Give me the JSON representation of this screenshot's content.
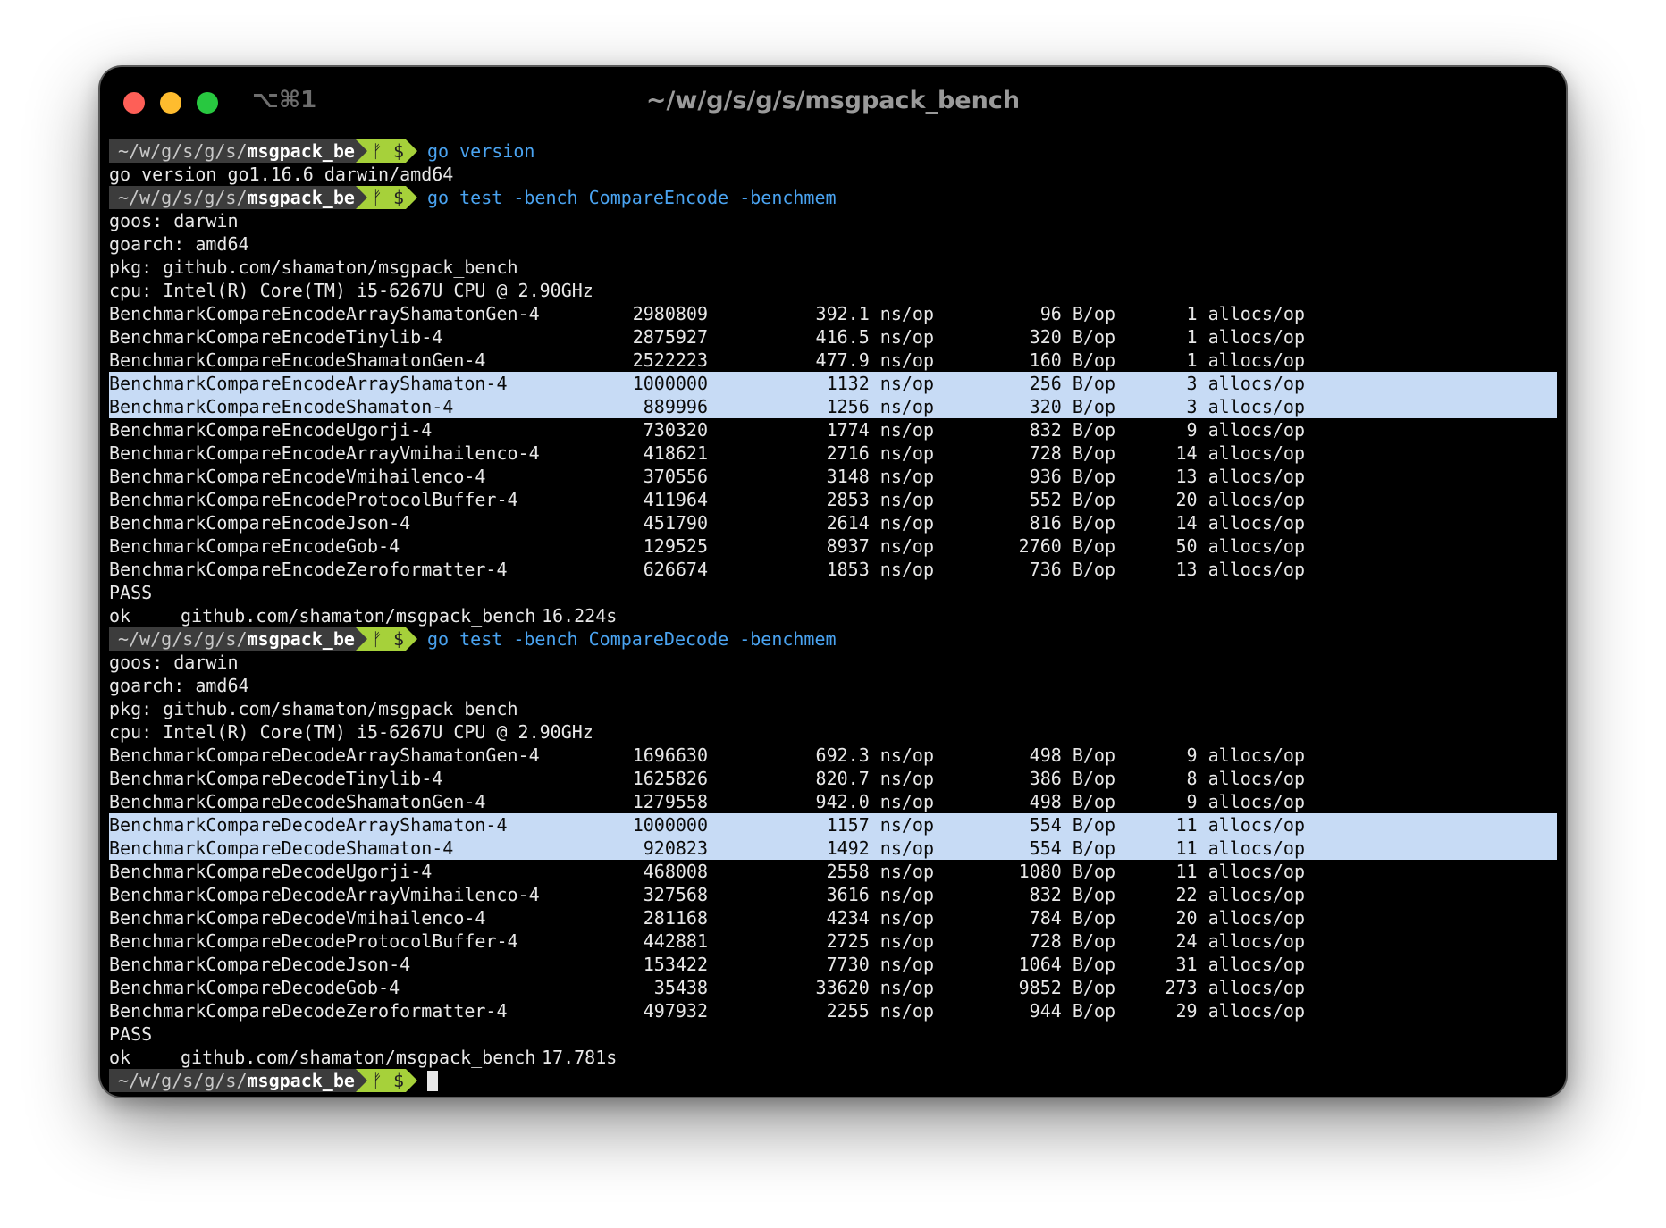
{
  "window": {
    "shortcut": "⌥⌘1",
    "title": "~/w/g/s/g/s/msgpack_bench"
  },
  "prompt": {
    "path_prefix": "~/w/g/s/g/s/",
    "path_dir": "msgpack_bench",
    "git_symbol": "ᚠ $"
  },
  "cmd1": {
    "command": "go version",
    "output": "go version go1.16.6 darwin/amd64"
  },
  "encode": {
    "command": "go test -bench CompareEncode -benchmem",
    "goos": "goos: darwin",
    "goarch": "goarch: amd64",
    "pkg": "pkg: github.com/shamaton/msgpack_bench",
    "cpu": "cpu: Intel(R) Core(TM) i5-6267U CPU @ 2.90GHz",
    "rows": [
      {
        "name": "BenchmarkCompareEncodeArrayShamatonGen-4",
        "iter": "2980809",
        "ns": "392.1 ns/op",
        "bytes": "96 B/op",
        "allocs": "1 allocs/op"
      },
      {
        "name": "BenchmarkCompareEncodeTinylib-4",
        "iter": "2875927",
        "ns": "416.5 ns/op",
        "bytes": "320 B/op",
        "allocs": "1 allocs/op"
      },
      {
        "name": "BenchmarkCompareEncodeShamatonGen-4",
        "iter": "2522223",
        "ns": "477.9 ns/op",
        "bytes": "160 B/op",
        "allocs": "1 allocs/op"
      },
      {
        "name": "BenchmarkCompareEncodeArrayShamaton-4",
        "iter": "1000000",
        "ns": "1132 ns/op",
        "bytes": "256 B/op",
        "allocs": "3 allocs/op"
      },
      {
        "name": "BenchmarkCompareEncodeShamaton-4",
        "iter": "889996",
        "ns": "1256 ns/op",
        "bytes": "320 B/op",
        "allocs": "3 allocs/op"
      },
      {
        "name": "BenchmarkCompareEncodeUgorji-4",
        "iter": "730320",
        "ns": "1774 ns/op",
        "bytes": "832 B/op",
        "allocs": "9 allocs/op"
      },
      {
        "name": "BenchmarkCompareEncodeArrayVmihailenco-4",
        "iter": "418621",
        "ns": "2716 ns/op",
        "bytes": "728 B/op",
        "allocs": "14 allocs/op"
      },
      {
        "name": "BenchmarkCompareEncodeVmihailenco-4",
        "iter": "370556",
        "ns": "3148 ns/op",
        "bytes": "936 B/op",
        "allocs": "13 allocs/op"
      },
      {
        "name": "BenchmarkCompareEncodeProtocolBuffer-4",
        "iter": "411964",
        "ns": "2853 ns/op",
        "bytes": "552 B/op",
        "allocs": "20 allocs/op"
      },
      {
        "name": "BenchmarkCompareEncodeJson-4",
        "iter": "451790",
        "ns": "2614 ns/op",
        "bytes": "816 B/op",
        "allocs": "14 allocs/op"
      },
      {
        "name": "BenchmarkCompareEncodeGob-4",
        "iter": "129525",
        "ns": "8937 ns/op",
        "bytes": "2760 B/op",
        "allocs": "50 allocs/op"
      },
      {
        "name": "BenchmarkCompareEncodeZeroformatter-4",
        "iter": "626674",
        "ns": "1853 ns/op",
        "bytes": "736 B/op",
        "allocs": "13 allocs/op"
      }
    ],
    "pass": "PASS",
    "ok_label": "ok",
    "ok_pkg": "github.com/shamaton/msgpack_bench",
    "ok_time": "16.224s"
  },
  "decode": {
    "command": "go test -bench CompareDecode -benchmem",
    "goos": "goos: darwin",
    "goarch": "goarch: amd64",
    "pkg": "pkg: github.com/shamaton/msgpack_bench",
    "cpu": "cpu: Intel(R) Core(TM) i5-6267U CPU @ 2.90GHz",
    "rows": [
      {
        "name": "BenchmarkCompareDecodeArrayShamatonGen-4",
        "iter": "1696630",
        "ns": "692.3 ns/op",
        "bytes": "498 B/op",
        "allocs": "9 allocs/op"
      },
      {
        "name": "BenchmarkCompareDecodeTinylib-4",
        "iter": "1625826",
        "ns": "820.7 ns/op",
        "bytes": "386 B/op",
        "allocs": "8 allocs/op"
      },
      {
        "name": "BenchmarkCompareDecodeShamatonGen-4",
        "iter": "1279558",
        "ns": "942.0 ns/op",
        "bytes": "498 B/op",
        "allocs": "9 allocs/op"
      },
      {
        "name": "BenchmarkCompareDecodeArrayShamaton-4",
        "iter": "1000000",
        "ns": "1157 ns/op",
        "bytes": "554 B/op",
        "allocs": "11 allocs/op"
      },
      {
        "name": "BenchmarkCompareDecodeShamaton-4",
        "iter": "920823",
        "ns": "1492 ns/op",
        "bytes": "554 B/op",
        "allocs": "11 allocs/op"
      },
      {
        "name": "BenchmarkCompareDecodeUgorji-4",
        "iter": "468008",
        "ns": "2558 ns/op",
        "bytes": "1080 B/op",
        "allocs": "11 allocs/op"
      },
      {
        "name": "BenchmarkCompareDecodeArrayVmihailenco-4",
        "iter": "327568",
        "ns": "3616 ns/op",
        "bytes": "832 B/op",
        "allocs": "22 allocs/op"
      },
      {
        "name": "BenchmarkCompareDecodeVmihailenco-4",
        "iter": "281168",
        "ns": "4234 ns/op",
        "bytes": "784 B/op",
        "allocs": "20 allocs/op"
      },
      {
        "name": "BenchmarkCompareDecodeProtocolBuffer-4",
        "iter": "442881",
        "ns": "2725 ns/op",
        "bytes": "728 B/op",
        "allocs": "24 allocs/op"
      },
      {
        "name": "BenchmarkCompareDecodeJson-4",
        "iter": "153422",
        "ns": "7730 ns/op",
        "bytes": "1064 B/op",
        "allocs": "31 allocs/op"
      },
      {
        "name": "BenchmarkCompareDecodeGob-4",
        "iter": "35438",
        "ns": "33620 ns/op",
        "bytes": "9852 B/op",
        "allocs": "273 allocs/op"
      },
      {
        "name": "BenchmarkCompareDecodeZeroformatter-4",
        "iter": "497932",
        "ns": "2255 ns/op",
        "bytes": "944 B/op",
        "allocs": "29 allocs/op"
      }
    ],
    "pass": "PASS",
    "ok_label": "ok",
    "ok_pkg": "github.com/shamaton/msgpack_bench",
    "ok_time": "17.781s"
  }
}
